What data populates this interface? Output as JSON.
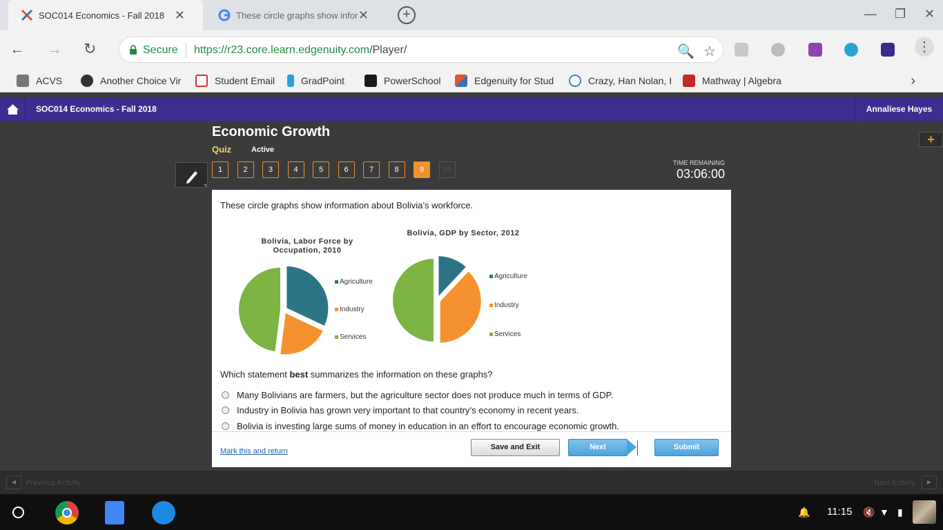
{
  "browser": {
    "tabs": [
      {
        "title": "SOC014 Economics - Fall 2018",
        "active": true
      },
      {
        "title": "These circle graphs show infor",
        "active": false
      }
    ],
    "secure_label": "Secure",
    "url_host": "https://r23.core.learn.edgenuity.com",
    "url_path": "/Player/",
    "bookmarks": [
      {
        "label": "ACVS",
        "icon": "folder-icon"
      },
      {
        "label": "Another Choice Vir",
        "icon": "another-choice-icon"
      },
      {
        "label": "Student Email",
        "icon": "gmail-icon"
      },
      {
        "label": "GradPoint",
        "icon": "gradpoint-icon"
      },
      {
        "label": "PowerSchool",
        "icon": "powerschool-icon"
      },
      {
        "label": "Edgenuity for Stud",
        "icon": "edgenuity-icon"
      },
      {
        "label": "Crazy, Han Nolan, I",
        "icon": "globe-icon"
      },
      {
        "label": "Mathway | Algebra",
        "icon": "mathway-icon"
      }
    ]
  },
  "header": {
    "course_title": "SOC014 Economics - Fall 2018",
    "user_name": "Annaliese Hayes"
  },
  "lesson": {
    "title": "Economic Growth",
    "activity_type": "Quiz",
    "status": "Active",
    "question_numbers": [
      "1",
      "2",
      "3",
      "4",
      "5",
      "6",
      "7",
      "8",
      "9",
      "10"
    ],
    "current_question": "9",
    "timer_label": "TIME REMAINING",
    "timer_value": "03:06:00"
  },
  "question": {
    "stem": "These circle graphs show information about Bolivia’s workforce.",
    "prompt_before": "Which statement ",
    "prompt_bold": "best",
    "prompt_after": " summarizes the information on these graphs?",
    "options": [
      "Many Bolivians are farmers, but the agriculture sector does not produce much in terms of GDP.",
      "Industry in Bolivia has grown very important to that country’s economy in recent years.",
      "Bolivia is investing large sums of money in education in an effort to encourage economic growth."
    ]
  },
  "footer": {
    "mark_link": "Mark this and return",
    "save_exit": "Save and Exit",
    "next": "Next",
    "submit": "Submit"
  },
  "activity_nav": {
    "previous": "Previous Activity",
    "next": "Next Activity"
  },
  "system": {
    "time": "11:15"
  },
  "colors": {
    "agriculture": "#2d7487",
    "industry": "#f5922f",
    "services": "#7cb342",
    "edgenuity_purple": "#3c2f8f",
    "accent_orange": "#f0932b"
  },
  "chart_data": [
    {
      "type": "pie",
      "title": "Bolivia, Labor Force by Occupation, 2010",
      "categories": [
        "Agriculture",
        "Industry",
        "Services"
      ],
      "values": [
        32,
        20,
        48
      ]
    },
    {
      "type": "pie",
      "title": "Bolivia, GDP by Sector, 2012",
      "categories": [
        "Agriculture",
        "Industry",
        "Services"
      ],
      "values": [
        12,
        38,
        50
      ]
    }
  ]
}
